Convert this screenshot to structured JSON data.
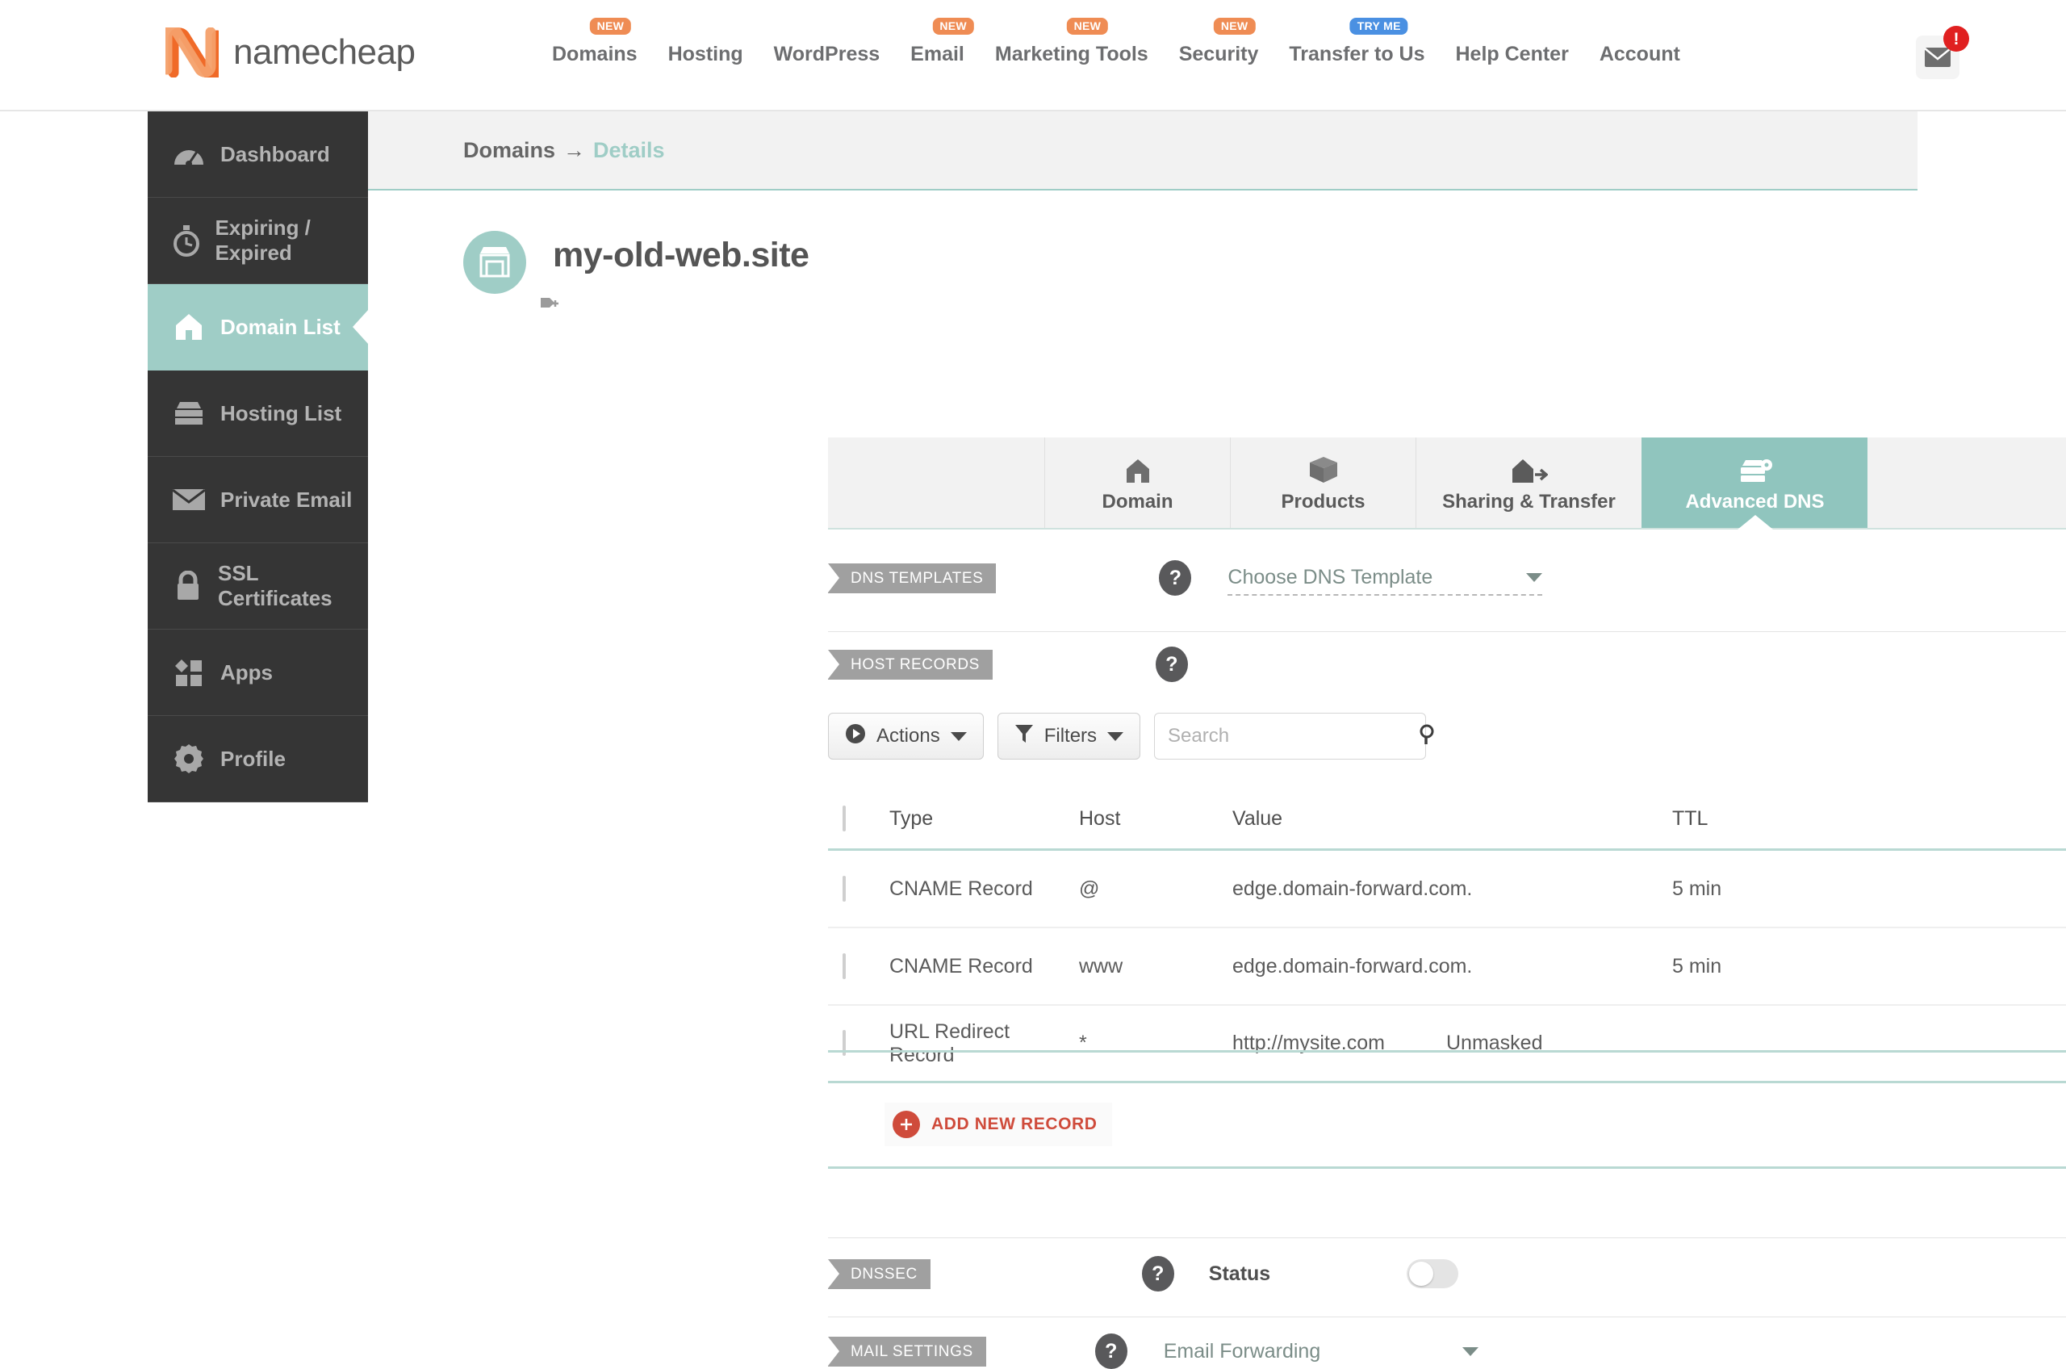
{
  "header": {
    "logo_text": "namecheap",
    "nav": [
      {
        "label": "Domains",
        "badge": "NEW",
        "badge_type": "new"
      },
      {
        "label": "Hosting",
        "badge": null,
        "badge_type": null
      },
      {
        "label": "WordPress",
        "badge": null,
        "badge_type": null
      },
      {
        "label": "Email",
        "badge": "NEW",
        "badge_type": "new"
      },
      {
        "label": "Marketing Tools",
        "badge": "NEW",
        "badge_type": "new"
      },
      {
        "label": "Security",
        "badge": "NEW",
        "badge_type": "new"
      },
      {
        "label": "Transfer to Us",
        "badge": "TRY ME",
        "badge_type": "tryme"
      },
      {
        "label": "Help Center",
        "badge": null,
        "badge_type": null
      },
      {
        "label": "Account",
        "badge": null,
        "badge_type": null
      }
    ],
    "mail_icon": "envelope-icon",
    "mail_badge": "!"
  },
  "sidebar": {
    "items": [
      {
        "label": "Dashboard",
        "icon": "speedometer-icon",
        "active": false
      },
      {
        "label": "Expiring / Expired",
        "icon": "stopwatch-icon",
        "active": false
      },
      {
        "label": "Domain List",
        "icon": "house-icon",
        "active": true
      },
      {
        "label": "Hosting List",
        "icon": "server-icon",
        "active": false
      },
      {
        "label": "Private Email",
        "icon": "envelope-icon",
        "active": false
      },
      {
        "label": "SSL Certificates",
        "icon": "padlock-icon",
        "active": false
      },
      {
        "label": "Apps",
        "icon": "shapes-icon",
        "active": false
      },
      {
        "label": "Profile",
        "icon": "gear-icon",
        "active": false
      }
    ]
  },
  "breadcrumb": {
    "root": "Domains",
    "separator": "→",
    "current": "Details"
  },
  "domain": {
    "name": "my-old-web.site",
    "avatar_icon": "storefront-icon",
    "tag_icon": "add-tag-icon"
  },
  "tabs": [
    {
      "label": "Domain",
      "icon": "house-icon",
      "active": false
    },
    {
      "label": "Products",
      "icon": "box-icon",
      "active": false
    },
    {
      "label": "Sharing & Transfer",
      "icon": "house-arrow-icon",
      "active": false
    },
    {
      "label": "Advanced DNS",
      "icon": "server-gear-icon",
      "active": true
    }
  ],
  "dns_templates": {
    "ribbon": "DNS TEMPLATES",
    "help": "?",
    "select_value": "Choose DNS Template"
  },
  "host_records": {
    "ribbon": "HOST RECORDS",
    "help": "?",
    "toolbar": {
      "actions_label": "Actions",
      "actions_icon": "play-circle-icon",
      "filters_label": "Filters",
      "filters_icon": "funnel-icon",
      "search_placeholder": "Search",
      "search_value": "",
      "search_icon": "magnifier-icon"
    },
    "columns": [
      "Type",
      "Host",
      "Value",
      "TTL"
    ],
    "rows": [
      {
        "type": "CNAME Record",
        "host": "@",
        "value": "edge.domain-forward.com.",
        "extra": "",
        "ttl": "5 min",
        "delete_icon": "trash-icon",
        "highlighted": false
      },
      {
        "type": "CNAME Record",
        "host": "www",
        "value": "edge.domain-forward.com.",
        "extra": "",
        "ttl": "5 min",
        "delete_icon": "trash-icon",
        "highlighted": false
      },
      {
        "type": "URL Redirect Record",
        "host": "*",
        "value": "http://mysite.com",
        "extra": "Unmasked",
        "ttl": "",
        "delete_icon": "trash-icon",
        "highlighted": true
      }
    ],
    "add_record_label": "ADD NEW RECORD",
    "add_record_icon": "plus-circle-icon"
  },
  "dnssec": {
    "ribbon": "DNSSEC",
    "help": "?",
    "status_label": "Status",
    "toggle_on": false
  },
  "mail_settings": {
    "ribbon": "MAIL SETTINGS",
    "help": "?",
    "select_value": "Email Forwarding"
  },
  "colors": {
    "accent_teal": "#9fcdc6",
    "tab_active": "#90c5be",
    "sidebar_dark": "#353535",
    "brand_orange": "#ef8c54",
    "badge_blue": "#4a90e2",
    "highlight_red": "#e8431f",
    "add_red": "#cf4b3b"
  }
}
